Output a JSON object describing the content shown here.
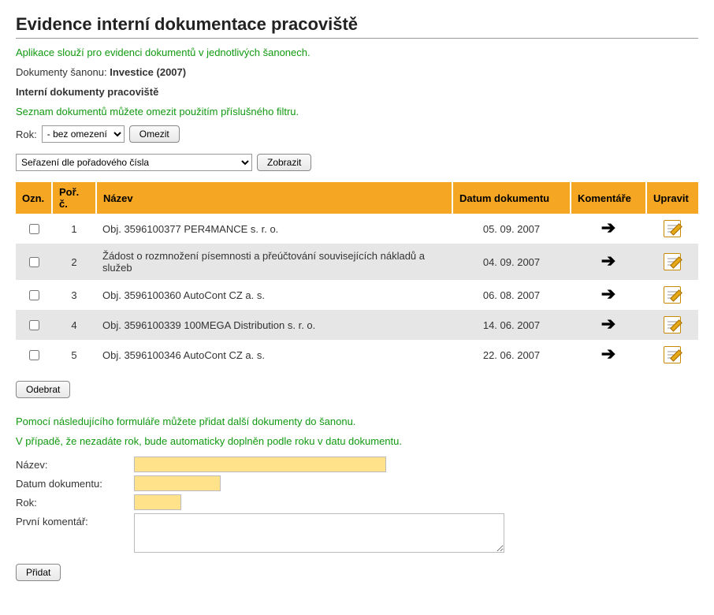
{
  "title": "Evidence interní dokumentace pracoviště",
  "app_note": "Aplikace slouží pro evidenci dokumentů v jednotlivých šanonech.",
  "binder_label": "Dokumenty šanonu:",
  "binder_value": "Investice (2007)",
  "subheading": "Interní dokumenty pracoviště",
  "filter_note": "Seznam dokumentů můžete omezit použitím příslušného filtru.",
  "year_label": "Rok:",
  "year_select_value": "- bez omezení -",
  "omezit_label": "Omezit",
  "sort_select_value": "Seřazení dle pořadového čísla",
  "zobrazit_label": "Zobrazit",
  "cols": {
    "ozn": "Ozn.",
    "por": "Poř. č.",
    "nazev": "Název",
    "date": "Datum dokumentu",
    "kom": "Komentáře",
    "upr": "Upravit"
  },
  "rows": [
    {
      "por": "1",
      "nazev": "Obj. 3596100377 PER4MANCE s. r. o.",
      "date": "05. 09. 2007"
    },
    {
      "por": "2",
      "nazev": "Žádost o rozmnožení písemnosti a přeúčtování souvisejících nákladů a služeb",
      "date": "04. 09. 2007"
    },
    {
      "por": "3",
      "nazev": "Obj. 3596100360 AutoCont CZ a. s.",
      "date": "06. 08. 2007"
    },
    {
      "por": "4",
      "nazev": "Obj. 3596100339 100MEGA Distribution s. r. o.",
      "date": "14. 06. 2007"
    },
    {
      "por": "5",
      "nazev": "Obj. 3596100346 AutoCont CZ a. s.",
      "date": "22. 06. 2007"
    }
  ],
  "odebrat_label": "Odebrat",
  "add_note1": "Pomocí následujícího formuláře můžete přidat další dokumenty do šanonu.",
  "add_note2": "V případě, že nezadáte rok, bude automaticky doplněn podle roku v datu dokumentu.",
  "form": {
    "nazev_label": "Název:",
    "date_label": "Datum dokumentu:",
    "rok_label": "Rok:",
    "comment_label": "První komentář:",
    "nazev_value": "",
    "date_value": "",
    "rok_value": "",
    "comment_value": ""
  },
  "pridat_label": "Přidat"
}
